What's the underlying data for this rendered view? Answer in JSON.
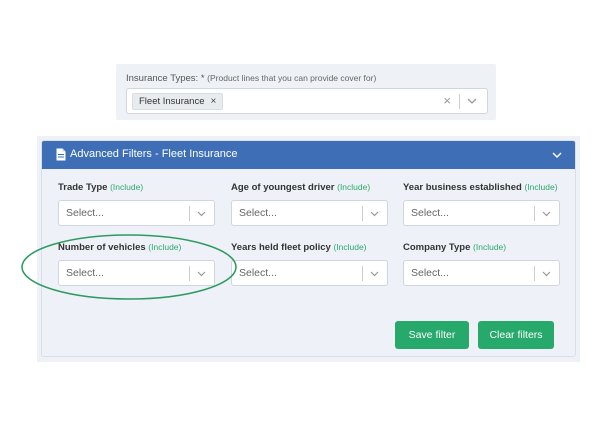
{
  "insurance_types": {
    "label": "Insurance Types: *",
    "hint": "(Product lines that you can provide cover for)",
    "selected_tag": "Fleet Insurance",
    "tag_remove": "×",
    "clear": "×"
  },
  "filters_card": {
    "title": "Advanced Filters - Fleet Insurance",
    "include_label": "(Include)",
    "fields": [
      {
        "label": "Trade Type",
        "placeholder": "Select..."
      },
      {
        "label": "Age of youngest driver",
        "placeholder": "Select..."
      },
      {
        "label": "Year business established",
        "placeholder": "Select..."
      },
      {
        "label": "Number of vehicles",
        "placeholder": "Select..."
      },
      {
        "label": "Years held fleet policy",
        "placeholder": "Select..."
      },
      {
        "label": "Company Type",
        "placeholder": "Select..."
      }
    ],
    "save_label": "Save filter",
    "clear_label": "Clear filters"
  },
  "colors": {
    "header_blue": "#3e6fb6",
    "button_green": "#26a96b",
    "include_green": "#2ea868",
    "highlight_ellipse": "#2e9a5e"
  },
  "icons": {
    "header": "document-icon",
    "collapse": "chevron-down-icon"
  }
}
